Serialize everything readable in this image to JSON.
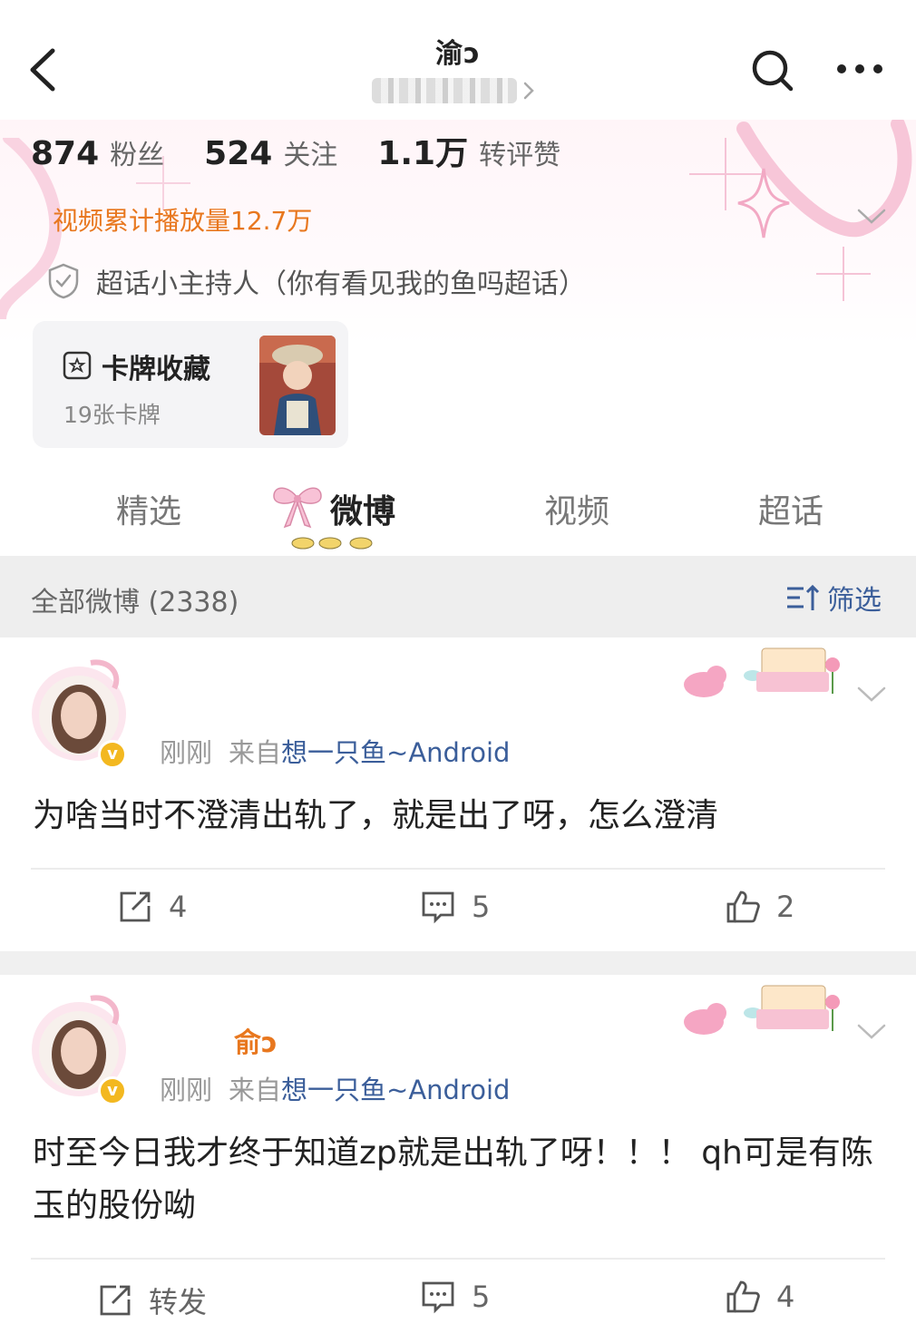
{
  "header": {
    "title": "渝ᴐ",
    "back_icon": "chevron-left-icon",
    "search_icon": "search-icon",
    "more_icon": "more-icon"
  },
  "stats": [
    {
      "value": "874",
      "label": "粉丝"
    },
    {
      "value": "524",
      "label": "关注"
    },
    {
      "value": "1.1万",
      "label": "转评赞"
    }
  ],
  "video_plays": "视频累计播放量12.7万",
  "badge": "超话小主持人（你有看见我的鱼吗超话）",
  "card_collection": {
    "title": "卡牌收藏",
    "subtitle": "19张卡牌"
  },
  "tabs": [
    {
      "label": "精选",
      "active": false
    },
    {
      "label": "微博",
      "active": true
    },
    {
      "label": "视频",
      "active": false
    },
    {
      "label": "超话",
      "active": false
    }
  ],
  "filter": {
    "count_label": "全部微博 (2338)",
    "button_label": "筛选"
  },
  "posts": [
    {
      "username": "",
      "time": "刚刚",
      "source_prefix": "来自",
      "source": "想一只鱼~Android",
      "text": "为啥当时不澄清出轨了，就是出了呀，怎么澄清",
      "actions": {
        "repost": "4",
        "comment": "5",
        "like": "2"
      }
    },
    {
      "username": "俞ᴐ",
      "time": "刚刚",
      "source_prefix": "来自",
      "source": "想一只鱼~Android",
      "text": "时至今日我才终于知道zp就是出轨了呀！！！ qh可是有陈玉的股份呦",
      "actions": {
        "repost": "转发",
        "comment": "5",
        "like": "4"
      }
    }
  ],
  "colors": {
    "accent_orange": "#e8771e",
    "link_blue": "#3b5e9a",
    "verify_gold": "#f3b820"
  }
}
